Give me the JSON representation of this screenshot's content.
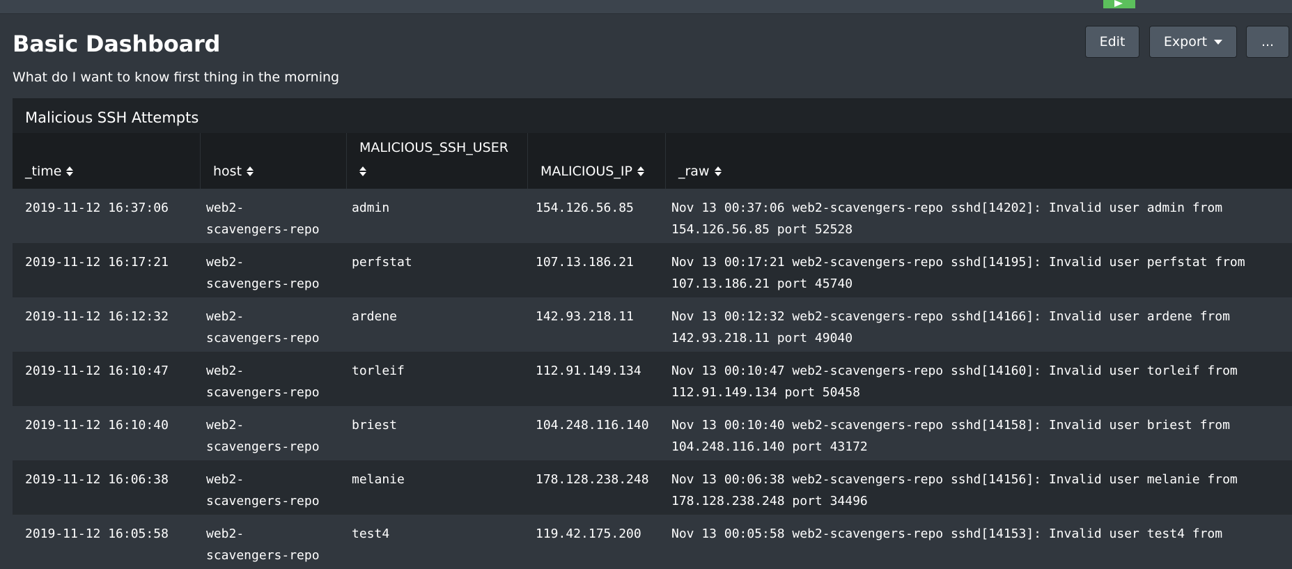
{
  "dashboard": {
    "title": "Basic Dashboard",
    "description": "What do I want to know first thing in the morning"
  },
  "toolbar": {
    "edit_label": "Edit",
    "export_label": "Export",
    "more_label": "..."
  },
  "panel": {
    "title": "Malicious SSH Attempts",
    "columns": [
      "_time",
      "host",
      "MALICIOUS_SSH_USER",
      "MALICIOUS_IP",
      "_raw"
    ],
    "rows": [
      {
        "time": "2019-11-12 16:37:06",
        "host": "web2-scavengers-repo",
        "user": "admin",
        "ip": "154.126.56.85",
        "raw1": "Nov 13 00:37:06 web2-scavengers-repo sshd[14202]: Invalid user admin from",
        "raw2": "154.126.56.85 port 52528"
      },
      {
        "time": "2019-11-12 16:17:21",
        "host": "web2-scavengers-repo",
        "user": "perfstat",
        "ip": "107.13.186.21",
        "raw1": "Nov 13 00:17:21 web2-scavengers-repo sshd[14195]: Invalid user perfstat from",
        "raw2": "107.13.186.21 port 45740"
      },
      {
        "time": "2019-11-12 16:12:32",
        "host": "web2-scavengers-repo",
        "user": "ardene",
        "ip": "142.93.218.11",
        "raw1": "Nov 13 00:12:32 web2-scavengers-repo sshd[14166]: Invalid user ardene from",
        "raw2": "142.93.218.11 port 49040"
      },
      {
        "time": "2019-11-12 16:10:47",
        "host": "web2-scavengers-repo",
        "user": "torleif",
        "ip": "112.91.149.134",
        "raw1": "Nov 13 00:10:47 web2-scavengers-repo sshd[14160]: Invalid user torleif from",
        "raw2": "112.91.149.134 port 50458"
      },
      {
        "time": "2019-11-12 16:10:40",
        "host": "web2-scavengers-repo",
        "user": "briest",
        "ip": "104.248.116.140",
        "raw1": "Nov 13 00:10:40 web2-scavengers-repo sshd[14158]: Invalid user briest from",
        "raw2": "104.248.116.140 port 43172"
      },
      {
        "time": "2019-11-12 16:06:38",
        "host": "web2-scavengers-repo",
        "user": "melanie",
        "ip": "178.128.238.248",
        "raw1": "Nov 13 00:06:38 web2-scavengers-repo sshd[14156]: Invalid user melanie from",
        "raw2": "178.128.238.248 port 34496"
      },
      {
        "time": "2019-11-12 16:05:58",
        "host": "web2-scavengers-repo",
        "user": "test4",
        "ip": "119.42.175.200",
        "raw1": "Nov 13 00:05:58 web2-scavengers-repo sshd[14153]: Invalid user test4 from",
        "raw2": ""
      }
    ]
  },
  "icons": {
    "run": "play-icon",
    "export_caret": "caret-down-icon",
    "sort": "sort-icon"
  },
  "colors": {
    "background": "#31373e",
    "panel": "#1f2327",
    "header": "#1a1d20",
    "button": "#4f5964",
    "accent_green": "#5cc05c"
  }
}
